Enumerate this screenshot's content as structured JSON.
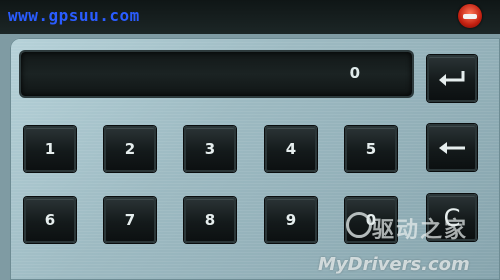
{
  "header": {
    "site_text": "www.gpsuu.com"
  },
  "display": {
    "value": "0"
  },
  "keypad": {
    "keys": [
      "1",
      "2",
      "3",
      "4",
      "5",
      "6",
      "7",
      "8",
      "9",
      "0"
    ],
    "clear_label": "C",
    "enter_icon": "enter-icon",
    "backspace_icon": "backspace-icon"
  },
  "watermark": {
    "text": "MyDrivers.com",
    "cn_text": "驱动之家"
  },
  "colors": {
    "panel": "#9dbac2",
    "key": "#141a1b",
    "site_text": "#2a5cff",
    "close_button": "#c21f10"
  }
}
